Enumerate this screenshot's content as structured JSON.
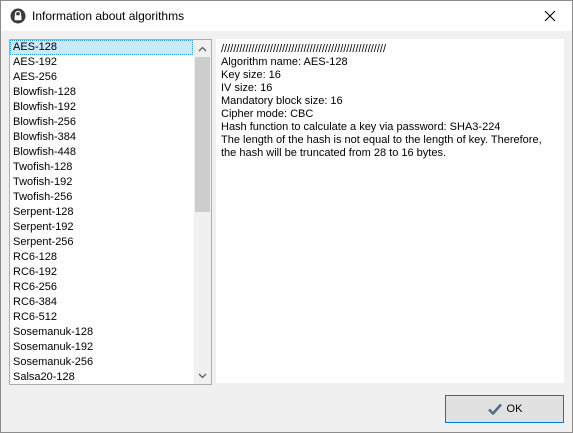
{
  "window": {
    "title": "Information about algorithms",
    "icon": "lock-icon",
    "close_icon": "close-icon"
  },
  "algorithm_list": {
    "selected_index": 0,
    "items": [
      "AES-128",
      "AES-192",
      "AES-256",
      "Blowfish-128",
      "Blowfish-192",
      "Blowfish-256",
      "Blowfish-384",
      "Blowfish-448",
      "Twofish-128",
      "Twofish-192",
      "Twofish-256",
      "Serpent-128",
      "Serpent-192",
      "Serpent-256",
      "RC6-128",
      "RC6-192",
      "RC6-256",
      "RC6-384",
      "RC6-512",
      "Sosemanuk-128",
      "Sosemanuk-192",
      "Sosemanuk-256",
      "Salsa20-128"
    ]
  },
  "info": {
    "lines": [
      "//////////////////////////////////////////////////////",
      "Algorithm name: AES-128",
      "Key size: 16",
      "IV size: 16",
      "Mandatory block size: 16",
      "Cipher mode: CBC",
      "Hash function to calculate a key via password: SHA3-224",
      "The length of the hash is not equal to the length of key. Therefore, the hash will be truncated from 28 to 16 bytes."
    ]
  },
  "ok_button": {
    "label": "OK",
    "icon": "checkmark-icon",
    "check_color": "#5a6b7d"
  },
  "colors": {
    "selection_bg": "#cce8ff",
    "focus_border": "#0078d7"
  }
}
